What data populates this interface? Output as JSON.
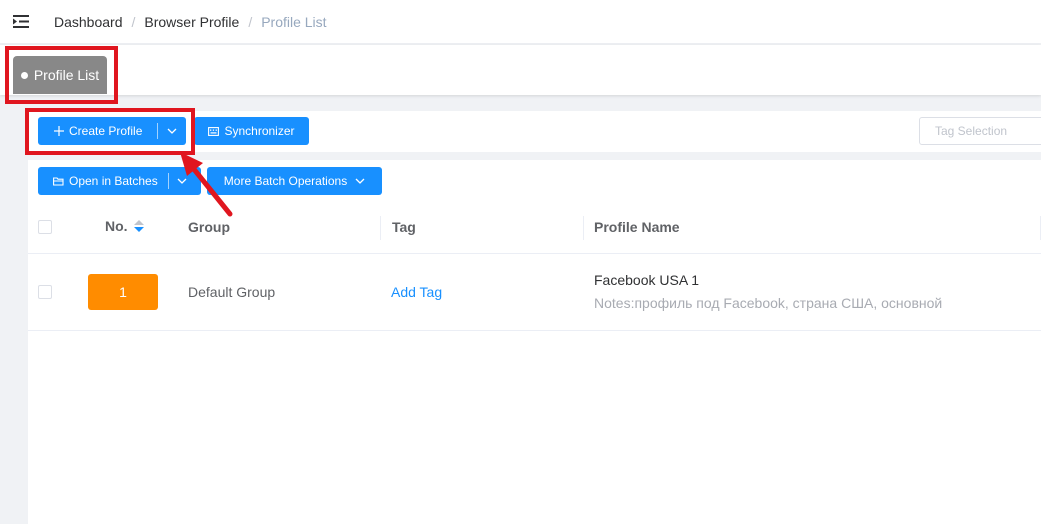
{
  "header": {
    "menu_icon": "indent-menu-icon",
    "breadcrumb": [
      "Dashboard",
      "Browser Profile",
      "Profile List"
    ],
    "separator": "/"
  },
  "tags_bar": {
    "active_tag": "Profile List"
  },
  "toolbar": {
    "create_profile": "Create Profile",
    "synchronizer": "Synchronizer",
    "open_in_batches": "Open in Batches",
    "more_batch_operations": "More Batch Operations",
    "tag_selection_placeholder": "Tag Selection"
  },
  "table": {
    "headers": {
      "no": "No.",
      "group": "Group",
      "tag": "Tag",
      "profile_name": "Profile Name"
    },
    "rows": [
      {
        "no": "1",
        "group": "Default Group",
        "tag_action": "Add Tag",
        "profile_name": "Facebook USA 1",
        "notes": "Notes:профиль под Facebook, страна США, основной"
      }
    ]
  },
  "colors": {
    "primary": "#1890ff",
    "number_badge": "#ff8c00",
    "active_tag_bg": "#888888",
    "annotation": "#e0161f"
  }
}
